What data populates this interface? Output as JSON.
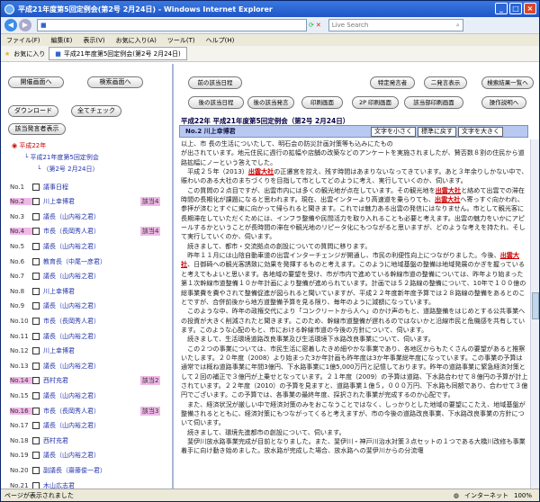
{
  "window": {
    "title": "平成21年度第5回定例会(第2号 2月24日) - Windows Internet Explorer",
    "min": "_",
    "max": "□",
    "close": "×"
  },
  "address": {
    "url": "",
    "search": "Live Search"
  },
  "menu": [
    "ファイル(F)",
    "編集(E)",
    "表示(V)",
    "お気に入り(A)",
    "ツール(T)",
    "ヘルプ(H)"
  ],
  "favorites": {
    "label": "お気に入り",
    "tab": "平成21年度第5回定例会(第2号 2月24日)"
  },
  "left": {
    "buttons": {
      "kaigi": "開催画面へ",
      "kensaku": "検索画面へ",
      "download": "ダウンロード",
      "allcheck": "全てチェック",
      "speakers": "該当発言者表示"
    },
    "tree": [
      "平成22年",
      "平成21年度第5回定例会",
      "（第2号 2月24日）"
    ],
    "rows": [
      {
        "no": "No.1",
        "name": "議事日程",
        "tag": ""
      },
      {
        "no": "No.2",
        "name": "川上幸博君",
        "tag": "該当4"
      },
      {
        "no": "No.3",
        "name": "議長（山内裕之君）",
        "tag": ""
      },
      {
        "no": "No.4",
        "name": "市長（長岡秀人君）",
        "tag": "該当4"
      },
      {
        "no": "No.5",
        "name": "議長（山内裕之君）",
        "tag": ""
      },
      {
        "no": "No.6",
        "name": "教育長（中尾一彦君）",
        "tag": ""
      },
      {
        "no": "No.7",
        "name": "議長（山内裕之君）",
        "tag": ""
      },
      {
        "no": "No.8",
        "name": "川上幸博君",
        "tag": ""
      },
      {
        "no": "No.9",
        "name": "議長（山内裕之君）",
        "tag": ""
      },
      {
        "no": "No.10",
        "name": "市長（長岡秀人君）",
        "tag": ""
      },
      {
        "no": "No.11",
        "name": "議長（山内裕之君）",
        "tag": ""
      },
      {
        "no": "No.12",
        "name": "川上幸博君",
        "tag": ""
      },
      {
        "no": "No.13",
        "name": "議長（山内裕之君）",
        "tag": ""
      },
      {
        "no": "No.14",
        "name": "西村充君",
        "tag": "該当2"
      },
      {
        "no": "No.15",
        "name": "議長（山内裕之君）",
        "tag": ""
      },
      {
        "no": "No.16",
        "name": "市長（長岡秀人君）",
        "tag": "該当3"
      },
      {
        "no": "No.17",
        "name": "議長（山内裕之君）",
        "tag": ""
      },
      {
        "no": "No.18",
        "name": "西村充君",
        "tag": ""
      },
      {
        "no": "No.19",
        "name": "議長（山内裕之君）",
        "tag": ""
      },
      {
        "no": "No.20",
        "name": "副議長（齋藤俊一君）",
        "tag": ""
      },
      {
        "no": "No.21",
        "name": "木山広志君",
        "tag": ""
      }
    ]
  },
  "right": {
    "buttons": {
      "prev": "前の該当日程",
      "special": "特定発言者",
      "next2": "二発言表示",
      "results": "検索結果一覧へ",
      "prevspeech": "後の該当日程",
      "nextspeech": "後の該当発言",
      "print": "印刷画面",
      "print2": "2P 印刷画面",
      "hitprint": "該当部印刷画面",
      "help": "操作説明へ"
    },
    "session": "平成22年  平成21年度第5回定例会（第2号 2月24日）",
    "speaker": "No.2 川上幸博君",
    "font_small": "文字を小さく",
    "font_std": "標準に戻す",
    "font_large": "文字を大きく",
    "body": "以上、市 長の生活についたして、明石会の防災計画対策等も込みにたもの\nが出されています。地元住民に週行の拡幅や店舗の改築などのアンケートを実施されましたが、賛否数８割の住民から道路拡幅にノーという答えでした。\n　平成２５年（2013）出雲大社の正遷宮を控え、残す時間はあまりないなってきています。あと３年余りしかない中で、賑わいのある大社のまちづくりを目指して市としてどのように考え、実行していくのか、伺います。\n　この質問の２点目ですが、出雲市内には多くの観光地が点在しています。その観光地を出雲大社と絡めて出雲での滞在時間の長期化が課題になると思われます。現在、出雲インターより高速道を乗らりても、出雲大社へ寄っすぐ向かわれ、参拝が済むとすぐに東に向かって帰られると聞きます。これでは魅力ある出雲の発信にはなりません。市として観光客に長期滞在していただくためには、インフラ整備や民間活力を取り入れることも必要と考えます。出雲の魅力をいかにアピールするかということが長時間の滞在や観光地のリピータ化にもつながると思いますが、どのような考えを持たれ、そして実行していくのか、伺います。\n　続きまして、都市・交流拠点の創設についての質問に移ります。\n　昨年１１月には山陰自動車道の出雲インターチェンジが開通し、市民の利便性向上につながりました。今後、出雲大社、日御碕への観光客誘致に効果を発揮するものと考えます。このように地域基盤の整備は地域発展のかぎを握っていると考えてもよいと思います。各地域の要望を受け、市が市内で進めている幹線市道の整備については、昨年より始まった第１次幹線市道整備１０か年計画により整備が進められています。計画では５２路線の整備について、10年で１００億の総事業費を費やされて整備促進が図られると聞いていますが、平成２２年度新年度予算では２８路線の整備をあるとのことですが、合併前後から地方道整備予算を見る限り、毎年のように減額になっています。\n　このような中、昨年の政権交代により「コンクリートから人へ」のかけ声のもと、道路整備をはじめとする公共事業への投資が大きく削減されたと聞きます。このため、幹線市道整備が遅れるのではないかと沿線市民と危機感を共有しています。このような心配のもと、市における幹線市道の今後の方針について、伺います。\n　続きまして、生活環境道路改良事業及び生活環境下水路改良事業について、伺います。\n　この２つの事業については、市民生活に密着したきめ細やかな事業であり、各地区からもたくさんの要望があると推察いたします。２０年度（2008）より始まった3か年計画も昨年度は3か年事業総年度になっています。この事業の予算は通常では概ね道路事業に年間3億円、下水路事業に1億5,000万円と記憶しております。昨年の道路事業に緊急経済対策として２回の補正で３億円が上乗せとなっています。２１年度（2009）の予算は道路、下水路合わせて８億円の予算が計上されています。２２年度（2010）の予算を見ますと、道路事業１億５，０００万円、下水路も同額であり、合わせて３億円でございます。この予算では、各事業の最終年度、採択された事業が完成するのか心配です。\n　また、経済状況が厳しい中で経済対策のみをおこなうことではなく、しっかりとした地域の要望にこたえ、地域基盤が整備されるとともに、経済対策にもつながってくると考えますが、市の今後の道路改良事業、下水路改良事業の方針について伺います。\n　続きまして、環境先進都市の創設について、伺います。\n　斐伊川放水路事業完成が目前となりました。また、斐伊川・神戸川治水対策３点セットの１つである大橋川改修も事業着手に向け動き始めました。放水路が完成した場合、放水路への斐伊川からの分流堰"
  },
  "status": {
    "text": "ページが表示されました",
    "zone": "インターネット",
    "zoom": "100%"
  }
}
